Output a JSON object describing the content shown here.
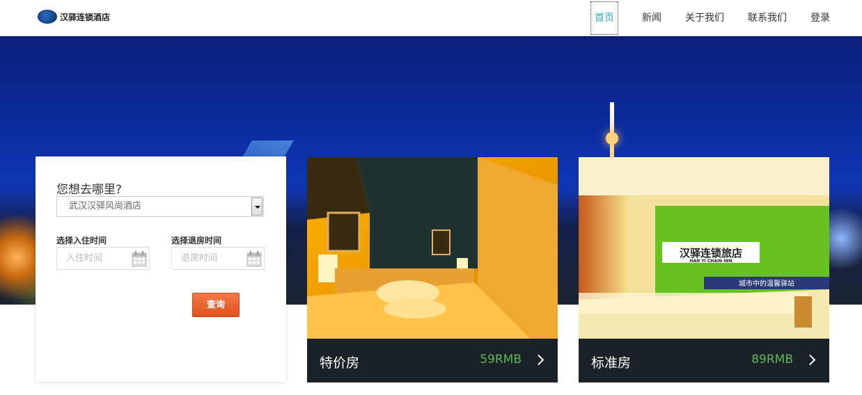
{
  "header": {
    "logo_text": "汉驿连锁酒店",
    "nav": [
      "首页",
      "新闻",
      "关于我们",
      "联系我们",
      "登录"
    ]
  },
  "search": {
    "title": "您想去哪里?",
    "hotel_selected": "武汉汉驿风尚酒店",
    "checkin_label": "选择入住时间",
    "checkin_placeholder": "入住时间",
    "checkout_label": "选择退房时间",
    "checkout_placeholder": "退房时间",
    "submit_label": "查询"
  },
  "rooms": [
    {
      "name": "特价房",
      "price": "59RMB"
    },
    {
      "name": "标准房",
      "price": "89RMB"
    }
  ],
  "signage": {
    "hotel_sign_cn": "汉驿连锁旅店",
    "hotel_sign_en": "HAN YI CHAIN INN",
    "slogan": "城市中的温馨驿站"
  },
  "colors": {
    "nav_active": "#2bb3c0",
    "query_button": "#e8622f",
    "price": "#5cb85c",
    "room_bar": "#1b2227"
  }
}
